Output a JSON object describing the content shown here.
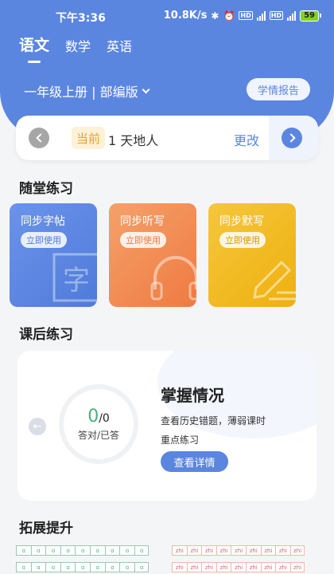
{
  "statusbar": {
    "time": "下午3:36",
    "network_speed": "10.8K/s",
    "battery": "59"
  },
  "subject_tabs": [
    {
      "label": "语文",
      "active": true
    },
    {
      "label": "数学",
      "active": false
    },
    {
      "label": "英语",
      "active": false
    }
  ],
  "grade": {
    "label": "一年级上册 | 部编版"
  },
  "report_button": {
    "label": "学情报告"
  },
  "lesson": {
    "current_tag": "当前",
    "name": "1 天地人",
    "change_label": "更改"
  },
  "in_class": {
    "title": "随堂练习",
    "cards": [
      {
        "title": "同步字帖",
        "button": "立即使用",
        "icon": "character-icon",
        "color": "#5b86e0"
      },
      {
        "title": "同步听写",
        "button": "立即使用",
        "icon": "headphones-icon",
        "color": "#ee7b42"
      },
      {
        "title": "同步默写",
        "button": "立即使用",
        "icon": "pencil-icon",
        "color": "#eeb00f"
      }
    ]
  },
  "after_class": {
    "title": "课后练习",
    "score_correct": "0",
    "score_total": "/0",
    "score_caption": "答对/已答",
    "mastery_title": "掌握情况",
    "mastery_desc_1": "查看历史错题，薄弱课时",
    "mastery_desc_2": "重点练习",
    "detail_button": "查看详情"
  },
  "extension": {
    "title": "拓展提升",
    "grid_left": [
      "ɑ",
      "ɑ",
      "ɑ",
      "ɑ",
      "ɑ",
      "ɑ",
      "ɑ",
      "ɑ",
      "ɑ"
    ],
    "grid_right": [
      "zhi",
      "zhi",
      "zhi",
      "zhi",
      "zhi",
      "zhi",
      "zhi",
      "zhi",
      "zhi"
    ]
  },
  "colors": {
    "accent": "#5b86e0",
    "current_tag": "#e6a23c",
    "score": "#4caf7a"
  }
}
